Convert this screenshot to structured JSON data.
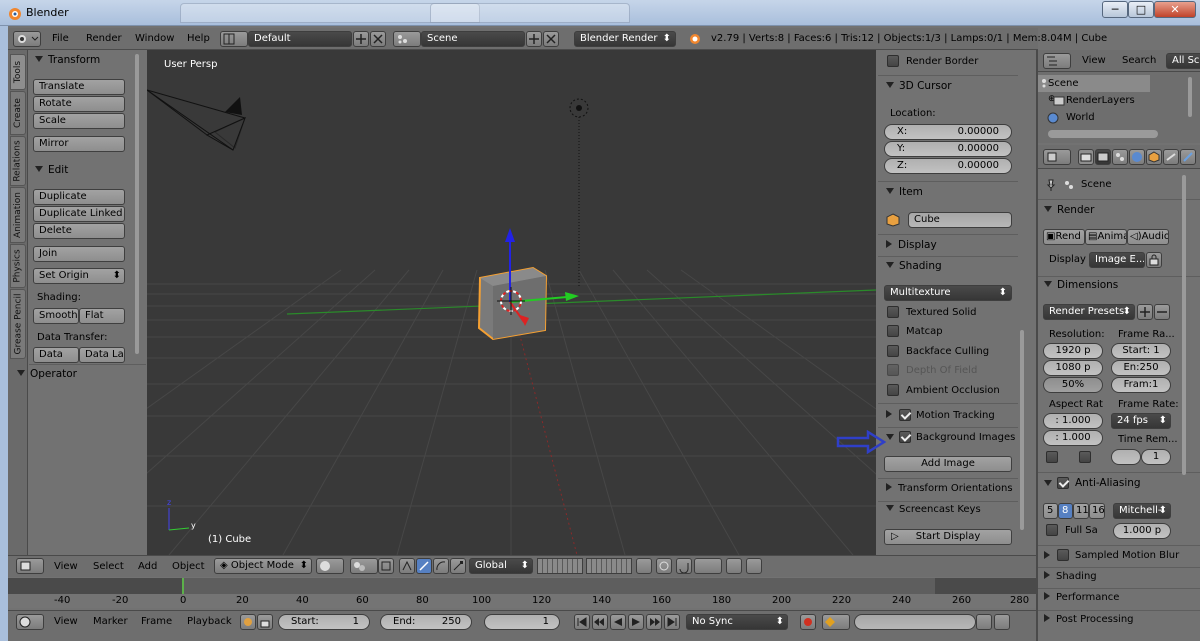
{
  "window": {
    "title": "Blender",
    "minimize": "─",
    "maximize": "□",
    "close": "✕"
  },
  "infobar": {
    "menus": [
      "File",
      "Render",
      "Window",
      "Help"
    ],
    "layout": "Default",
    "scene": "Scene",
    "engine": "Blender Render",
    "stats": "v2.79 | Verts:8 | Faces:6 | Tris:12 | Objects:1/3 | Lamps:0/1 | Mem:8.04M | Cube"
  },
  "left_tabs": [
    "Tools",
    "Create",
    "Relations",
    "Animation",
    "Physics",
    "Grease Pencil"
  ],
  "tools": {
    "transform_header": "Transform",
    "translate": "Translate",
    "rotate": "Rotate",
    "scale": "Scale",
    "mirror": "Mirror",
    "edit_header": "Edit",
    "duplicate": "Duplicate",
    "duplicate_linked": "Duplicate Linked",
    "delete": "Delete",
    "join": "Join",
    "set_origin": "Set Origin",
    "shading_label": "Shading:",
    "smooth": "Smooth",
    "flat": "Flat",
    "data_transfer_label": "Data Transfer:",
    "data": "Data",
    "data_la": "Data La",
    "operator_header": "Operator"
  },
  "viewport": {
    "view_label": "User Persp",
    "object_label": "(1) Cube"
  },
  "npanel": {
    "render_border": "Render Border",
    "cursor_header": "3D Cursor",
    "location_label": "Location:",
    "x_label": "X:",
    "x": "0.00000",
    "y_label": "Y:",
    "y": "0.00000",
    "z_label": "Z:",
    "z": "0.00000",
    "item_header": "Item",
    "item_name": "Cube",
    "display_header": "Display",
    "shading_header": "Shading",
    "shading_mode": "Multitexture",
    "textured_solid": "Textured Solid",
    "matcap": "Matcap",
    "backface_culling": "Backface Culling",
    "depth_of_field": "Depth Of Field",
    "ambient_occlusion": "Ambient Occlusion",
    "motion_tracking": "Motion Tracking",
    "background_images": "Background Images",
    "add_image": "Add Image",
    "transform_orientations": "Transform Orientations",
    "screencast_keys": "Screencast Keys",
    "start_display": "Start Display"
  },
  "outliner": {
    "view": "View",
    "search": "Search",
    "filter": "All Sc",
    "items": [
      "Scene",
      "RenderLayers",
      "World"
    ]
  },
  "properties": {
    "breadcrumb": "Scene",
    "render_header": "Render",
    "render_btn": "Rend",
    "anim_btn": "Anima",
    "audio_btn": "Audio",
    "display_label": "Display",
    "display_value": "Image E...",
    "dimensions_header": "Dimensions",
    "presets": "Render Presets",
    "resolution_label": "Resolution:",
    "res_x": "1920 p",
    "res_y": "1080 p",
    "res_pct": "50%",
    "frame_range_label": "Frame Ra...",
    "start": "Start: 1",
    "end": "En:250",
    "frame": "Fram:1",
    "aspect_label": "Aspect Rat",
    "aspect_x": ": 1.000",
    "aspect_y": ": 1.000",
    "frame_rate_label": "Frame Rate:",
    "fps": "24 fps",
    "time_remap_label": "Time Rem...",
    "time_remap_value": "1",
    "aa_header": "Anti-Aliasing",
    "aa_samples": [
      "5",
      "8",
      "11",
      "16"
    ],
    "aa_filter": "Mitchell-",
    "full_sample": "Full Sa",
    "filter_size": "1.000 p",
    "smb_header": "Sampled Motion Blur",
    "shading_header": "Shading",
    "performance_header": "Performance",
    "post_header": "Post Processing"
  },
  "header3d": {
    "menus": [
      "View",
      "Select",
      "Add",
      "Object"
    ],
    "mode": "Object Mode",
    "orientation": "Global"
  },
  "timeline": {
    "ticks": [
      "-40",
      "-20",
      "0",
      "20",
      "40",
      "60",
      "80",
      "100",
      "120",
      "140",
      "160",
      "180",
      "200",
      "220",
      "240",
      "260",
      "280"
    ]
  },
  "bottombar": {
    "menus": [
      "View",
      "Marker",
      "Frame",
      "Playback"
    ],
    "start": "Start:",
    "start_val": "1",
    "end": "End:",
    "end_val": "250",
    "current": "1",
    "sync": "No Sync"
  },
  "colors": {
    "annotation_arrow": "#2f3fc8",
    "selection_outline": "#f5a032",
    "x_axis": "#c83232",
    "y_axis": "#32c832",
    "z_axis": "#3232e6"
  }
}
